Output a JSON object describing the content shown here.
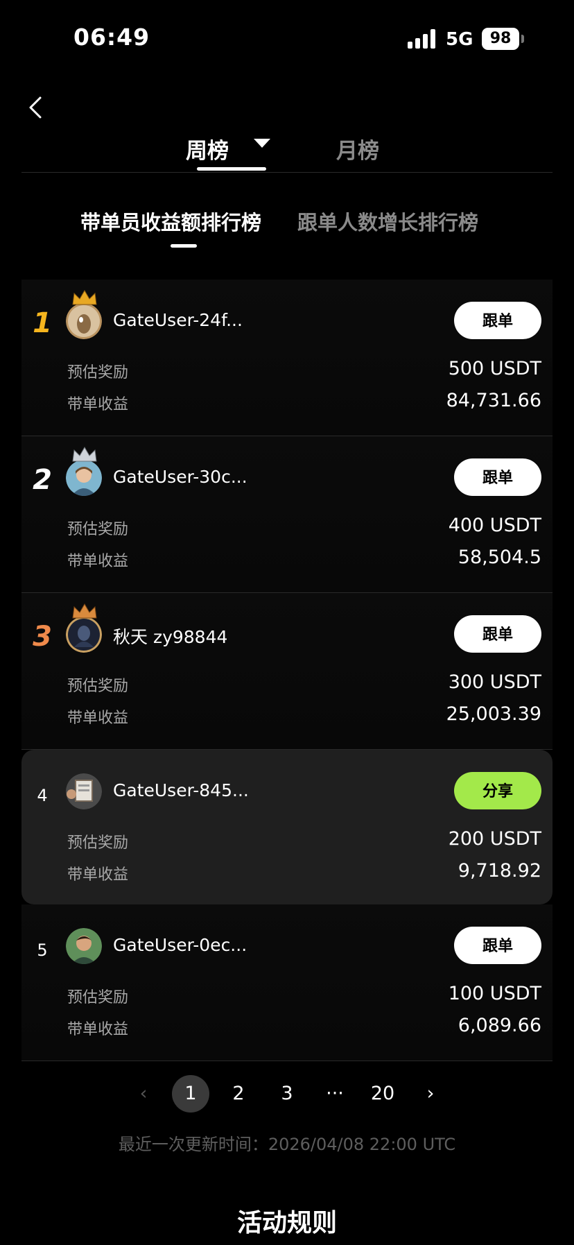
{
  "status_bar": {
    "time": "06:49",
    "network": "5G",
    "battery": "98"
  },
  "tabs": {
    "week": "周榜",
    "month": "月榜"
  },
  "sub_tabs": {
    "earnings": "带单员收益额排行榜",
    "growth": "跟单人数增长排行榜"
  },
  "labels": {
    "reward": "预估奖励",
    "earnings": "带单收益"
  },
  "colors": {
    "gold": "#f6b51e",
    "silver": "#ffffff",
    "bronze": "#f08a4b",
    "share_green": "#a3e94a"
  },
  "rows": [
    {
      "rank": "1",
      "name": "GateUser-24f...",
      "button": "跟单",
      "reward": "500 USDT",
      "earnings": "84,731.66"
    },
    {
      "rank": "2",
      "name": "GateUser-30c...",
      "button": "跟单",
      "reward": "400 USDT",
      "earnings": "58,504.5"
    },
    {
      "rank": "3",
      "name": "秋天 zy98844",
      "button": "跟单",
      "reward": "300 USDT",
      "earnings": "25,003.39"
    },
    {
      "rank": "4",
      "name": "GateUser-845...",
      "button": "分享",
      "reward": "200 USDT",
      "earnings": "9,718.92"
    },
    {
      "rank": "5",
      "name": "GateUser-0ec...",
      "button": "跟单",
      "reward": "100 USDT",
      "earnings": "6,089.66"
    }
  ],
  "pagination": {
    "prev": "‹",
    "pages": [
      "1",
      "2",
      "3",
      "···",
      "20"
    ],
    "next": "›"
  },
  "update_time": "最近一次更新时间：2026/04/08 22:00 UTC",
  "rules_title": "活动规则"
}
